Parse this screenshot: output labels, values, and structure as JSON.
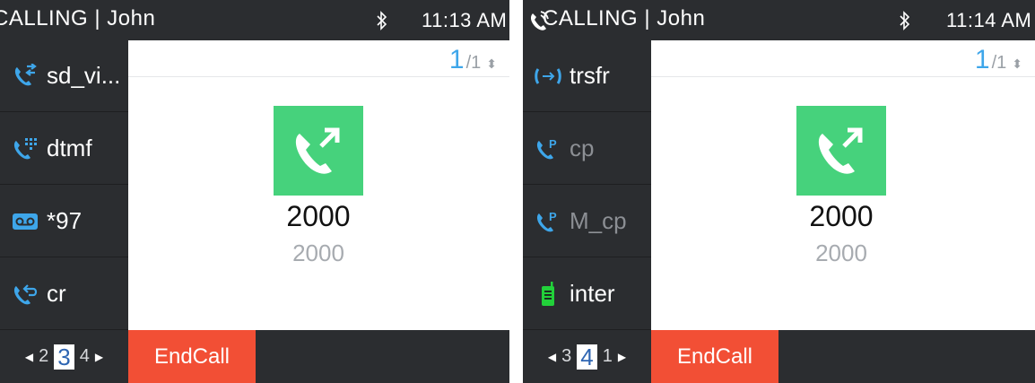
{
  "accent_colors": {
    "endcall": "#f24f35",
    "call_tile": "#46d27c",
    "counter": "#3ea6ea",
    "page_current": "#2f66b3"
  },
  "screens": [
    {
      "status": {
        "title": "CALLING | John",
        "title_shown": "CALLING | John",
        "time": "11:13 AM",
        "bluetooth_icon": "bluetooth-icon"
      },
      "side_keys": [
        {
          "label": "sd_vi...",
          "icon": "call-forward-icon",
          "dim": false
        },
        {
          "label": "dtmf",
          "icon": "dtmf-keypad-icon",
          "dim": false
        },
        {
          "label": "*97",
          "icon": "voicemail-icon",
          "dim": false
        },
        {
          "label": "cr",
          "icon": "call-return-icon",
          "dim": false
        }
      ],
      "pager": {
        "prev": "2",
        "current": "3",
        "next": "4"
      },
      "call_counter": {
        "current": "1",
        "total": "/1"
      },
      "call": {
        "icon": "outgoing-call-icon",
        "number": "2000",
        "name": "2000"
      },
      "softkey": {
        "label": "EndCall"
      }
    },
    {
      "status": {
        "title": "CALLING | John",
        "title_shown": "CALLING | John",
        "time": "11:14 AM",
        "bluetooth_icon": "bluetooth-icon"
      },
      "side_keys": [
        {
          "label": "trsfr",
          "icon": "transfer-icon",
          "dim": false
        },
        {
          "label": "cp",
          "icon": "call-park-icon",
          "dim": true
        },
        {
          "label": "M_cp",
          "icon": "call-park-icon",
          "dim": true
        },
        {
          "label": "inter",
          "icon": "intercom-icon",
          "dim": false
        }
      ],
      "pager": {
        "prev": "3",
        "current": "4",
        "next": "1"
      },
      "call_counter": {
        "current": "1",
        "total": "/1"
      },
      "call": {
        "icon": "outgoing-call-icon",
        "number": "2000",
        "name": "2000"
      },
      "softkey": {
        "label": "EndCall"
      }
    }
  ]
}
